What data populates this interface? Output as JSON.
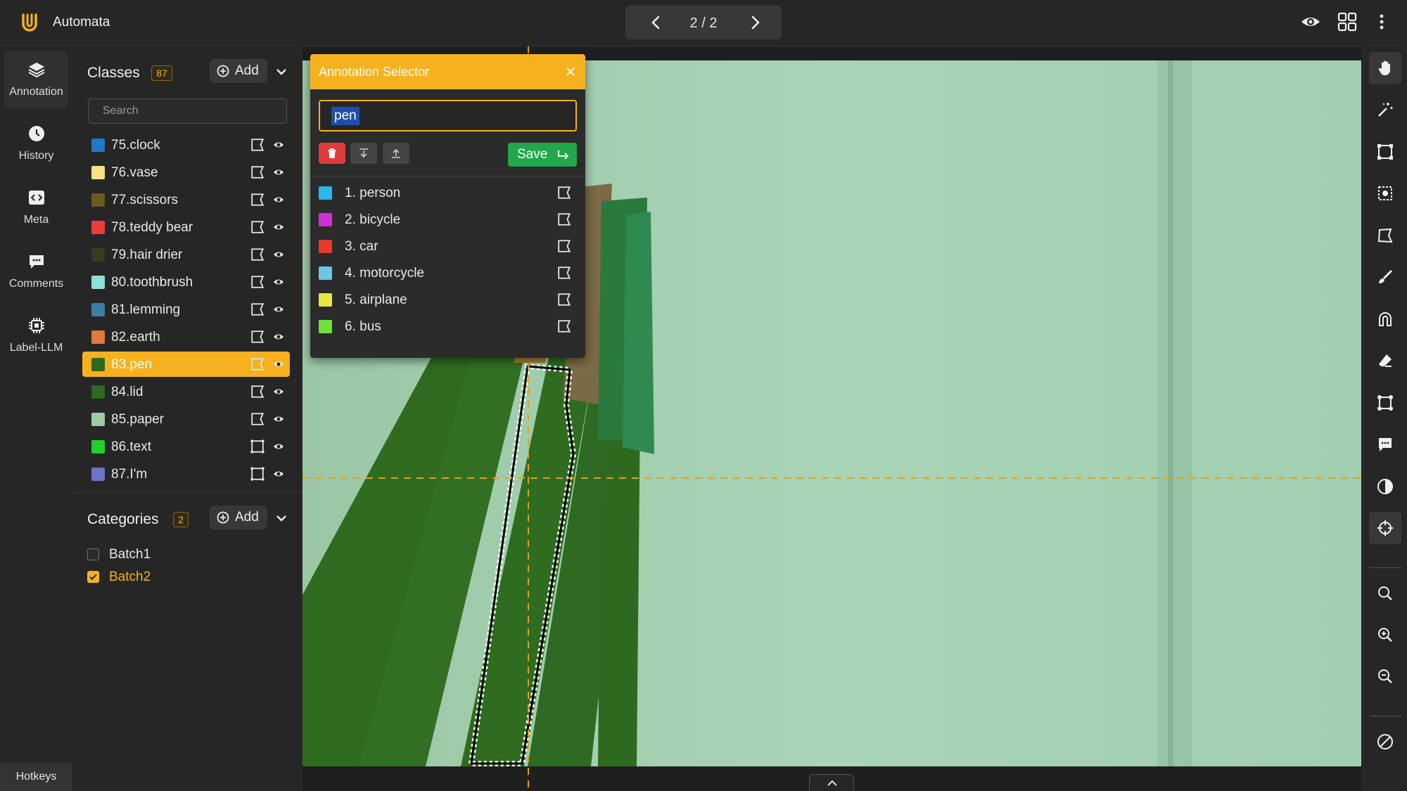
{
  "app": {
    "title": "Automata",
    "brand_color": "#f5b21e"
  },
  "pager": {
    "text": "2 / 2"
  },
  "rail": {
    "items": [
      {
        "label": "Annotation",
        "icon": "layers-icon"
      },
      {
        "label": "History",
        "icon": "clock-icon"
      },
      {
        "label": "Meta",
        "icon": "code-icon"
      },
      {
        "label": "Comments",
        "icon": "comment-icon"
      },
      {
        "label": "Label-LLM",
        "icon": "chip-icon"
      }
    ],
    "hotkeys": "Hotkeys"
  },
  "classes": {
    "title": "Classes",
    "count": "87",
    "add_label": "Add",
    "search_placeholder": "Search",
    "items": [
      {
        "label": "75.clock",
        "color": "#1f78c8",
        "shape": "polygon"
      },
      {
        "label": "76.vase",
        "color": "#f7e08a",
        "shape": "polygon"
      },
      {
        "label": "77.scissors",
        "color": "#6b5a1e",
        "shape": "polygon"
      },
      {
        "label": "78.teddy bear",
        "color": "#ee3a3a",
        "shape": "polygon"
      },
      {
        "label": "79.hair drier",
        "color": "#3d3a22",
        "shape": "polygon"
      },
      {
        "label": "80.toothbrush",
        "color": "#8de0d8",
        "shape": "polygon"
      },
      {
        "label": "81.lemming",
        "color": "#3c7ea8",
        "shape": "polygon"
      },
      {
        "label": "82.earth",
        "color": "#e07a3a",
        "shape": "polygon"
      },
      {
        "label": "83.pen",
        "color": "#2d6a1a",
        "shape": "polygon"
      },
      {
        "label": "84.lid",
        "color": "#2f6a22",
        "shape": "polygon"
      },
      {
        "label": "85.paper",
        "color": "#9ecba0",
        "shape": "polygon"
      },
      {
        "label": "86.text",
        "color": "#1fd12a",
        "shape": "rectangle"
      },
      {
        "label": "87.I'm",
        "color": "#6d73c8",
        "shape": "rectangle"
      }
    ]
  },
  "categories": {
    "title": "Categories",
    "count": "2",
    "add_label": "Add",
    "items": [
      {
        "label": "Batch1",
        "checked": false
      },
      {
        "label": "Batch2",
        "checked": true
      }
    ]
  },
  "annotation_selector": {
    "title": "Annotation Selector",
    "input_value": "pen",
    "save_label": "Save",
    "items": [
      {
        "label": "1. person",
        "color": "#2bb5e8"
      },
      {
        "label": "2. bicycle",
        "color": "#d02fd8"
      },
      {
        "label": "3. car",
        "color": "#e43b2f"
      },
      {
        "label": "4. motorcycle",
        "color": "#6cc7e3"
      },
      {
        "label": "5. airplane",
        "color": "#e8e83a"
      },
      {
        "label": "6. bus",
        "color": "#6ee23a"
      }
    ]
  }
}
